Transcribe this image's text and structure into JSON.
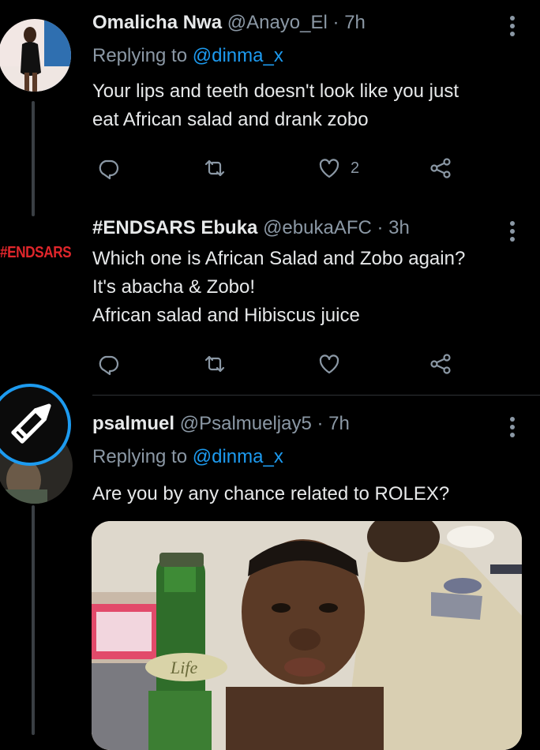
{
  "tweets": [
    {
      "name": "Omalicha Nwa",
      "handle": "@Anayo_El",
      "sep": "·",
      "time": "7h",
      "replying_prefix": "Replying to ",
      "replying_to": "@dinma_x",
      "text_lines": [
        "Your lips and teeth doesn't look like you just",
        "eat African salad and drank zobo"
      ],
      "like_count": "2"
    },
    {
      "name": "#ENDSARS Ebuka",
      "handle": "@ebukaAFC",
      "sep": "·",
      "time": "3h",
      "avatar_text": "#ENDSARS",
      "text_lines": [
        "Which one is African Salad and Zobo again?",
        "It's abacha & Zobo!",
        "African salad and Hibiscus juice"
      ]
    },
    {
      "name": "psalmuel",
      "handle": "@Psalmueljay5",
      "sep": "·",
      "time": "7h",
      "replying_prefix": "Replying to ",
      "replying_to": "@dinma_x",
      "text_lines": [
        "Are you by any chance related to ROLEX?"
      ],
      "media_label": "Life"
    }
  ],
  "colors": {
    "background": "#000000",
    "text": "#e7e9ea",
    "secondary": "#8b98a5",
    "accent": "#1d9bf0",
    "endsars_red": "#e0262b",
    "compose_ring": "#1d9bf0"
  },
  "icons": [
    "reply-icon",
    "retweet-icon",
    "like-icon",
    "share-icon",
    "more-icon",
    "compose-icon"
  ]
}
